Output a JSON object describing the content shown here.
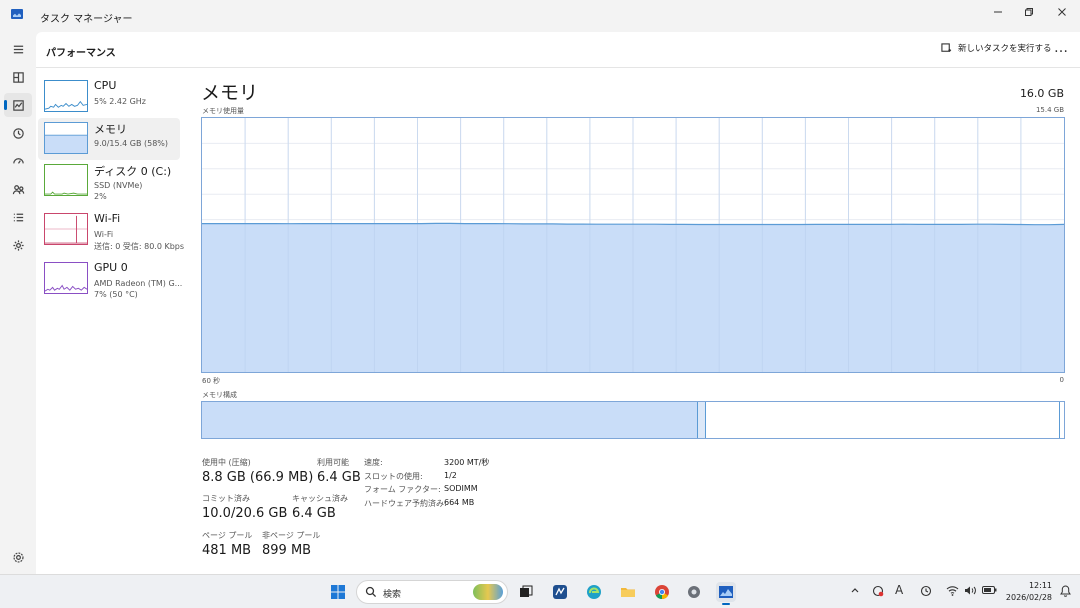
{
  "window": {
    "title": "タスク マネージャー",
    "controls": [
      "minimize-icon",
      "restore-icon",
      "close-icon"
    ]
  },
  "nav": {
    "items": [
      "menu-icon",
      "processes-icon",
      "performance-icon",
      "app-history-icon",
      "startup-icon",
      "users-icon",
      "details-icon",
      "services-icon"
    ],
    "settings": "settings-icon",
    "active": "performance-icon"
  },
  "header": {
    "title": "パフォーマンス",
    "run_task": "新しいタスクを実行する",
    "more": "…"
  },
  "sidebar": {
    "items": [
      {
        "name": "CPU",
        "sub1": "5% 2.42 GHz",
        "sub2": ""
      },
      {
        "name": "メモリ",
        "sub1": "9.0/15.4 GB (58%)",
        "sub2": ""
      },
      {
        "name": "ディスク 0 (C:)",
        "sub1": "SSD (NVMe)",
        "sub2": "2%"
      },
      {
        "name": "Wi-Fi",
        "sub1": "Wi-Fi",
        "sub2": "送信: 0 受信: 80.0 Kbps"
      },
      {
        "name": "GPU 0",
        "sub1": "AMD Radeon (TM) G...",
        "sub2": "7% (50 °C)"
      }
    ],
    "selected_index": 1
  },
  "main": {
    "title": "メモリ",
    "total": "16.0 GB",
    "usage_label": "メモリ使用量",
    "usage_max": "15.4 GB",
    "axis_left": "60 秒",
    "axis_right": "0",
    "composition_label": "メモリ構成",
    "composition": {
      "in_use_pct": 57.5,
      "modified_pct": 1.0,
      "standby_pct": 41.0
    }
  },
  "chart_data": {
    "type": "area",
    "title": "メモリ使用量",
    "xlabel": "",
    "ylabel": "",
    "x_range_label": [
      "60 秒",
      "0"
    ],
    "ylim": [
      0,
      15.4
    ],
    "unit": "GB",
    "series": [
      {
        "values": [
          9.0,
          9.0,
          9.0,
          9.0,
          9.0,
          9.0,
          8.99,
          9.0,
          9.0,
          9.0,
          9.0,
          9.0,
          9.0,
          9.0,
          9.0,
          9.0,
          9.01,
          9.01,
          9.0,
          9.0,
          9.0,
          8.99,
          8.98,
          8.98,
          8.98,
          8.97,
          8.97,
          8.96,
          8.96,
          8.96,
          8.96,
          8.96,
          8.95,
          8.95,
          8.94,
          8.94,
          8.94,
          8.94,
          8.94,
          8.94,
          8.94,
          8.94,
          8.95,
          8.95,
          8.95,
          8.95,
          8.95,
          8.95,
          8.96,
          8.95,
          8.95,
          8.95,
          8.95,
          8.96,
          8.96,
          8.95,
          8.94,
          8.93,
          8.93,
          8.95
        ]
      }
    ],
    "grid": true,
    "colors": {
      "fill": "#c9ddf8",
      "line": "#5b9bd5",
      "grid": "#e8ecf2"
    }
  },
  "stats": {
    "in_use_label": "使用中 (圧縮)",
    "in_use_value": "8.8 GB (66.9 MB)",
    "available_label": "利用可能",
    "available_value": "6.4 GB",
    "committed_label": "コミット済み",
    "committed_value": "10.0/20.6 GB",
    "cached_label": "キャッシュ済み",
    "cached_value": "6.4 GB",
    "paged_label": "ページ プール",
    "paged_value": "481 MB",
    "nonpaged_label": "非ページ プール",
    "nonpaged_value": "899 MB"
  },
  "details": [
    {
      "key": "速度:",
      "value": "3200 MT/秒"
    },
    {
      "key": "スロットの使用:",
      "value": "1/2"
    },
    {
      "key": "フォーム ファクター:",
      "value": "SODIMM"
    },
    {
      "key": "ハードウェア予約済み:",
      "value": "664 MB"
    }
  ],
  "taskbar": {
    "search_placeholder": "検索",
    "apps": [
      "start-icon",
      "search-icon",
      "widgets-icon",
      "taskview-icon",
      "feedback-icon",
      "edge-icon",
      "explorer-icon",
      "chrome-icon",
      "settings-icon",
      "task-manager-icon"
    ],
    "tray_icons": [
      "chevron-up-icon",
      "security-icon",
      "ime-icon",
      "alarm-icon",
      "wifi-icon",
      "volume-icon",
      "battery-icon",
      "bell-icon"
    ],
    "ime_label": "A",
    "time": "12:11",
    "date": "2026/02/28"
  },
  "colors": {
    "accent": "#0067c0",
    "memory_fill": "#c9ddf8",
    "memory_line": "#5b9bd5",
    "chart_border": "#7ea6d8"
  }
}
